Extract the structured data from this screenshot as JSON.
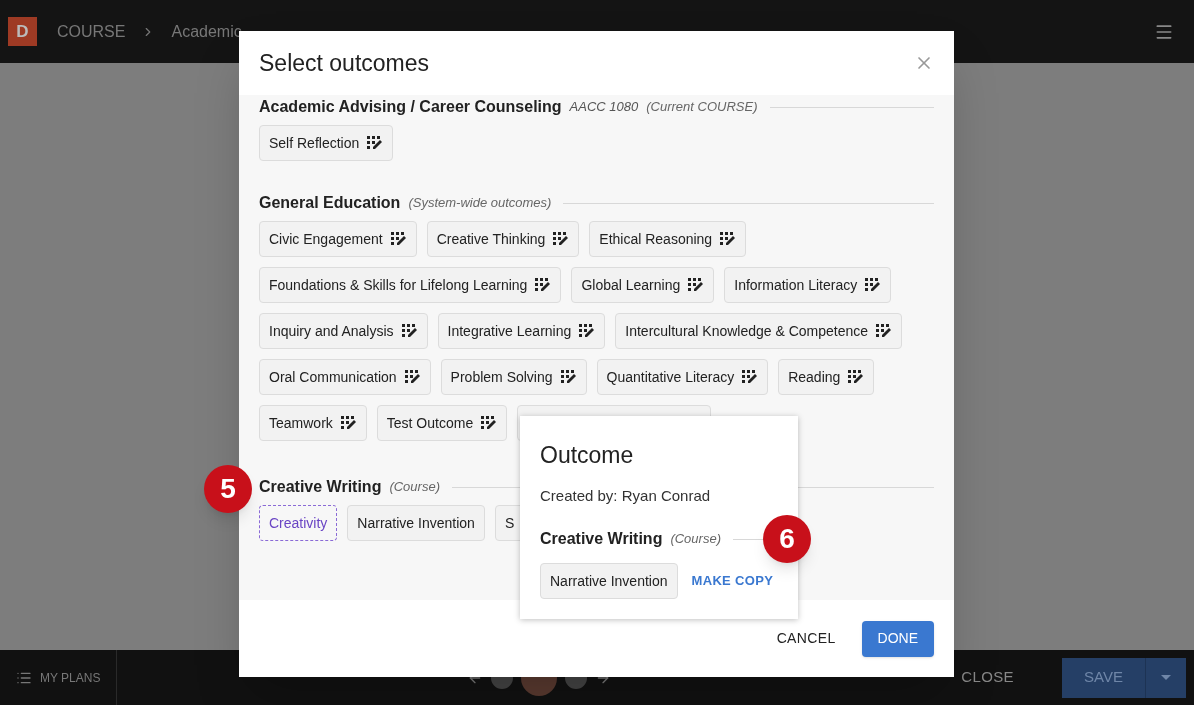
{
  "app_bar": {
    "logo": "D",
    "breadcrumb": [
      "COURSE",
      "Academic"
    ]
  },
  "dialog": {
    "title": "Select outcomes",
    "sections": [
      {
        "title": "Academic Advising / Career Counseling",
        "code": "AACC 1080",
        "note": "(Current COURSE)",
        "outcomes": [
          {
            "label": "Self Reflection",
            "kind": "rubric",
            "selected": false
          }
        ]
      },
      {
        "title": "General Education",
        "note": "(System-wide outcomes)",
        "outcomes": [
          {
            "label": "Civic Engagement",
            "kind": "rubric",
            "selected": false
          },
          {
            "label": "Creative Thinking",
            "kind": "rubric",
            "selected": false
          },
          {
            "label": "Ethical Reasoning",
            "kind": "rubric",
            "selected": false
          },
          {
            "label": "Foundations & Skills for Lifelong Learning",
            "kind": "rubric",
            "selected": false
          },
          {
            "label": "Global Learning",
            "kind": "rubric",
            "selected": false
          },
          {
            "label": "Information Literacy",
            "kind": "rubric",
            "selected": false
          },
          {
            "label": "Inquiry and Analysis",
            "kind": "rubric",
            "selected": false
          },
          {
            "label": "Integrative Learning",
            "kind": "rubric",
            "selected": false
          },
          {
            "label": "Intercultural Knowledge & Competence",
            "kind": "rubric",
            "selected": false
          },
          {
            "label": "Oral Communication",
            "kind": "rubric",
            "selected": false
          },
          {
            "label": "Problem Solving",
            "kind": "rubric",
            "selected": false
          },
          {
            "label": "Quantitative Literacy",
            "kind": "rubric",
            "selected": false
          },
          {
            "label": "Reading",
            "kind": "rubric",
            "selected": false
          },
          {
            "label": "Teamwork",
            "kind": "rubric",
            "selected": false
          },
          {
            "label": "Test Outcome",
            "kind": "rubric",
            "selected": false
          },
          {
            "kind": "covered",
            "selected": false
          }
        ]
      },
      {
        "title": "Creative Writing",
        "note": "(Course)",
        "outcomes": [
          {
            "label": "Creativity",
            "kind": "plain",
            "selected": true
          },
          {
            "label": "Narrative Invention",
            "kind": "plain",
            "selected": false
          },
          {
            "label": "S",
            "kind": "plain",
            "selected": false
          }
        ]
      }
    ],
    "popover": {
      "title": "Outcome",
      "created_by": "Created by: Ryan Conrad",
      "section": {
        "title": "Creative Writing",
        "note": "(Course)"
      },
      "outcome": "Narrative Invention",
      "action": "MAKE COPY"
    },
    "buttons": [
      {
        "label": "CANCEL",
        "kind": "text"
      },
      {
        "label": "DONE",
        "kind": "primary"
      }
    ]
  },
  "bottom_bar": {
    "my_plans": "MY PLANS",
    "close": "CLOSE",
    "save": "SAVE"
  },
  "callouts": [
    "5",
    "6"
  ]
}
